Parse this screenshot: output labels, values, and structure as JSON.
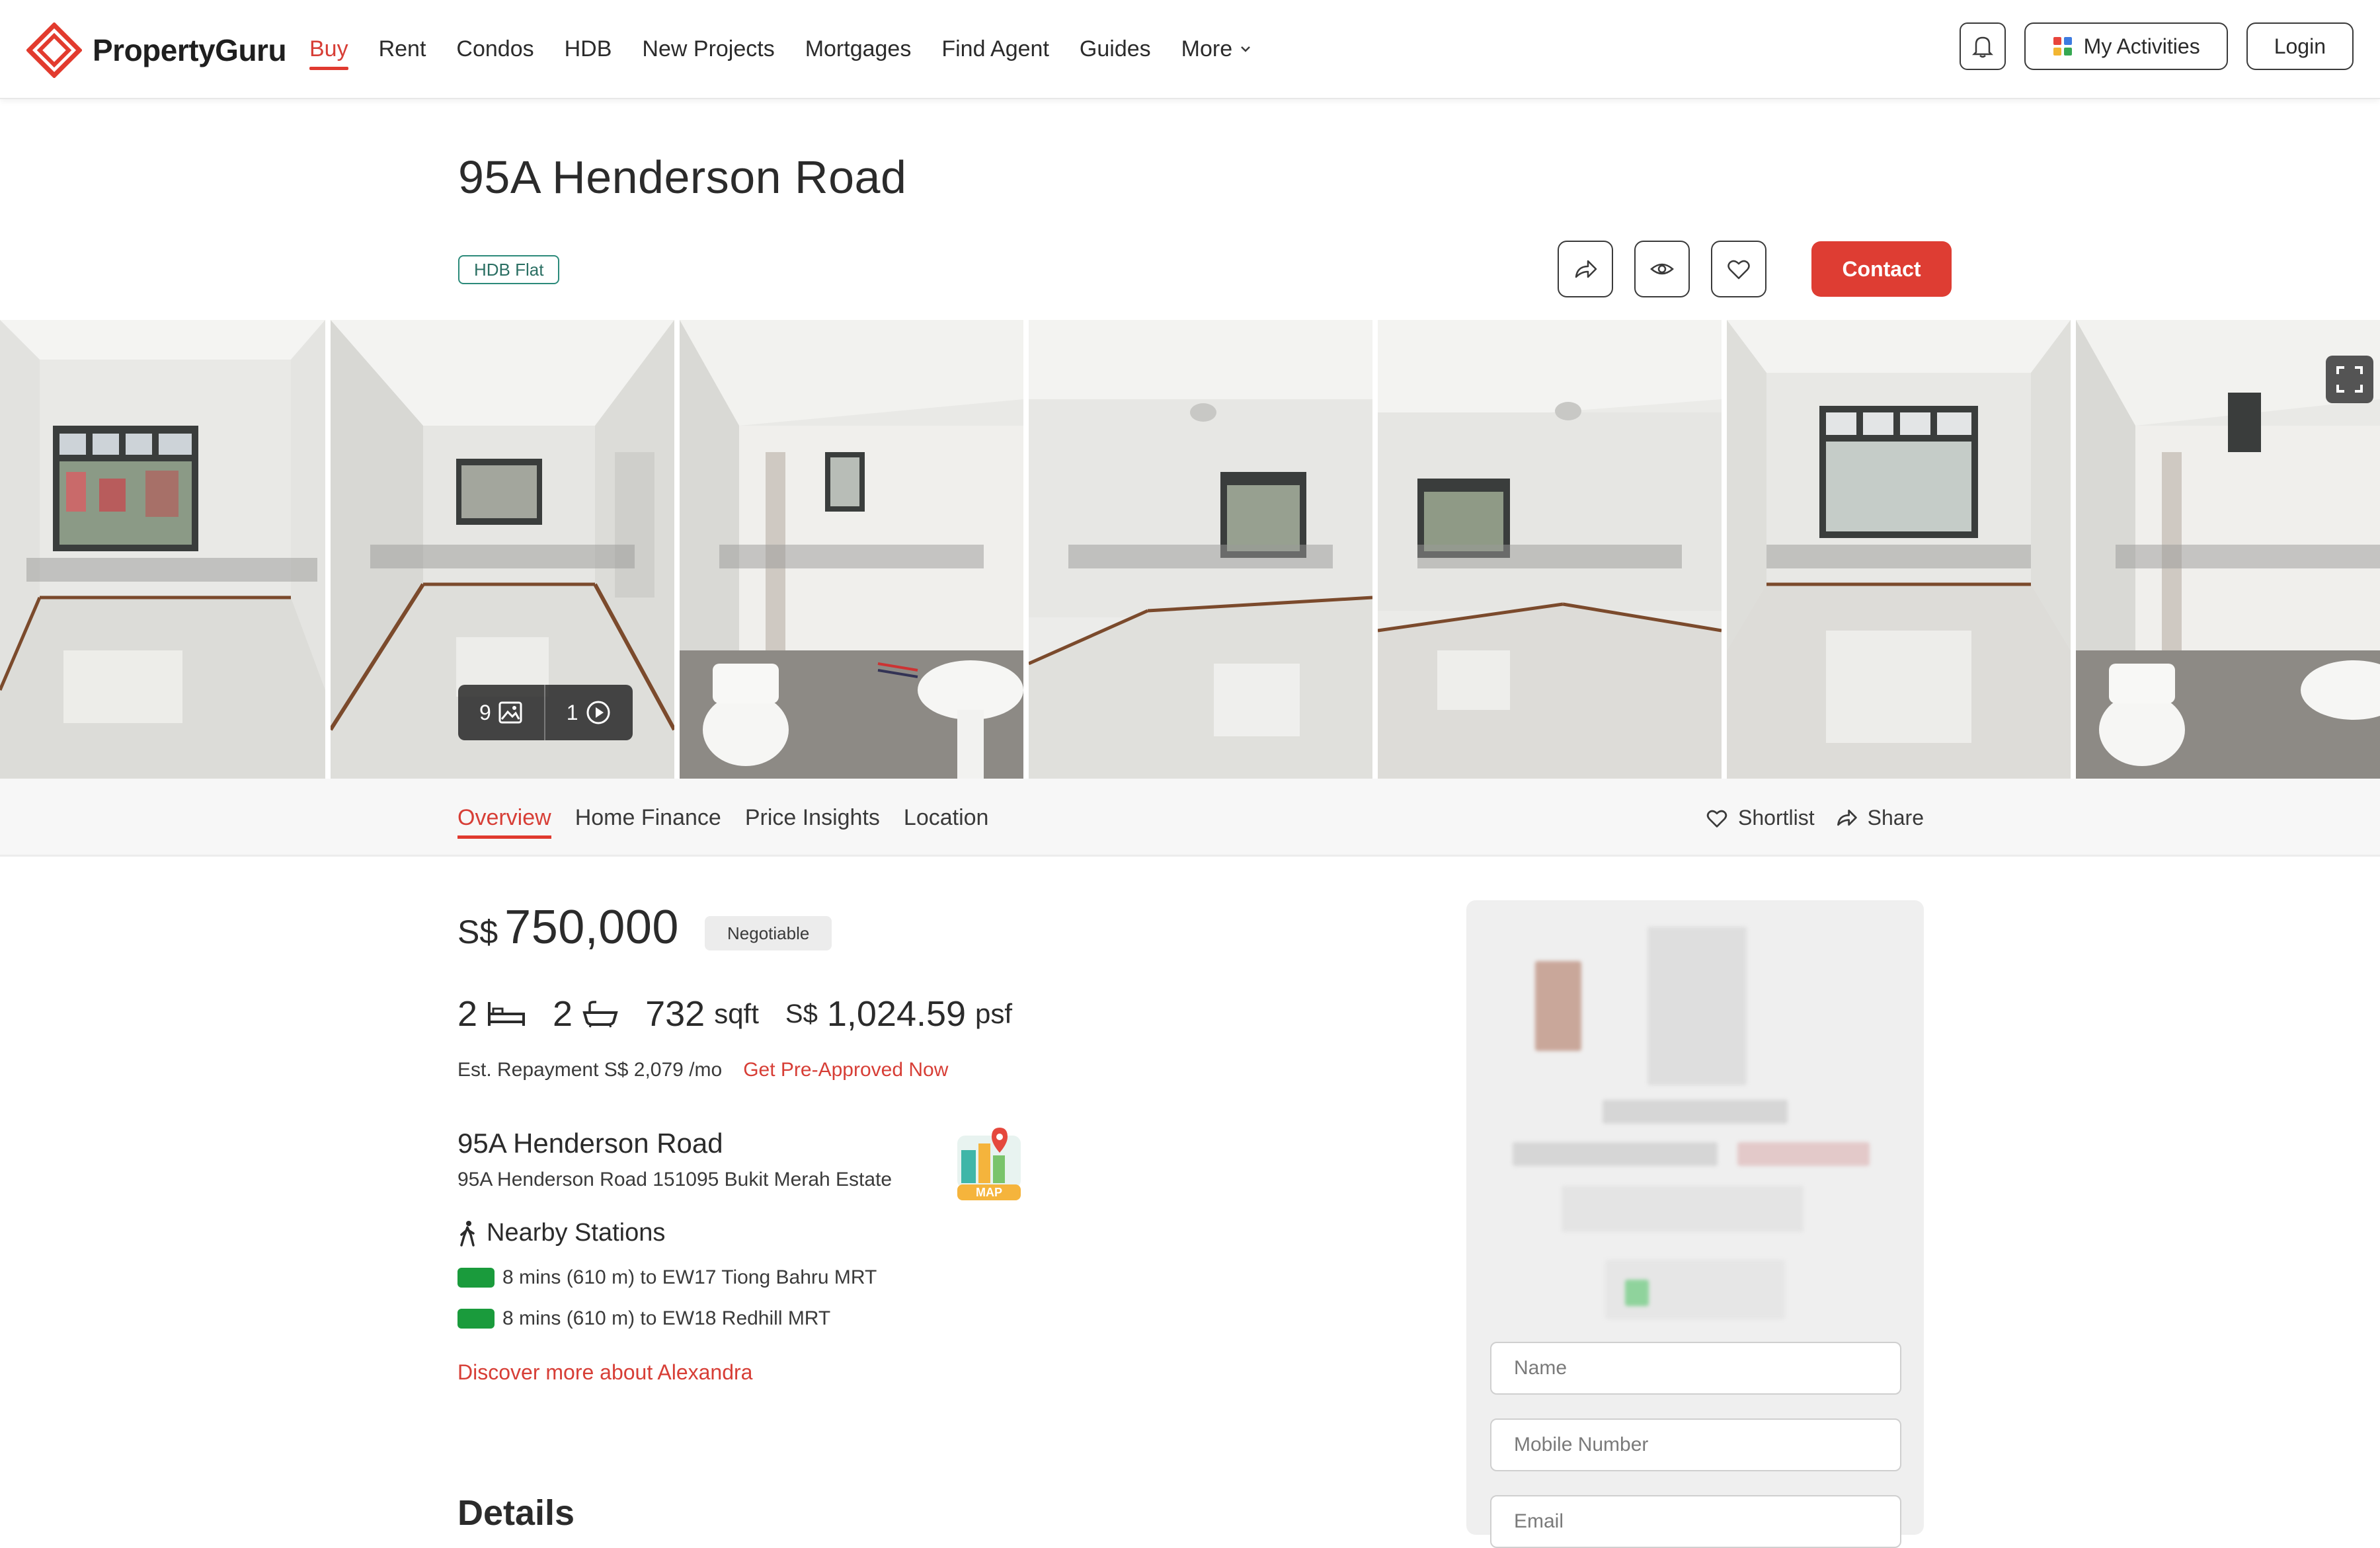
{
  "header": {
    "brand": "PropertyGuru",
    "nav": [
      {
        "label": "Buy",
        "active": true
      },
      {
        "label": "Rent"
      },
      {
        "label": "Condos"
      },
      {
        "label": "HDB"
      },
      {
        "label": "New Projects"
      },
      {
        "label": "Mortgages"
      },
      {
        "label": "Find Agent"
      },
      {
        "label": "Guides"
      },
      {
        "label": "More"
      }
    ],
    "my_activities": "My Activities",
    "login": "Login"
  },
  "listing": {
    "title": "95A Henderson Road",
    "type_tag": "HDB Flat",
    "contact_label": "Contact",
    "gallery": {
      "photo_count": "9",
      "video_count": "1"
    }
  },
  "subnav": {
    "tabs": [
      "Overview",
      "Home Finance",
      "Price Insights",
      "Location"
    ],
    "active_tab": "Overview",
    "shortlist": "Shortlist",
    "share": "Share"
  },
  "overview": {
    "currency": "S$",
    "price": "750,000",
    "negotiable": "Negotiable",
    "bedrooms": "2",
    "bathrooms": "2",
    "area_value": "732",
    "area_unit": "sqft",
    "psf_currency": "S$",
    "psf_value": "1,024.59",
    "psf_unit": "psf",
    "repayment": "Est. Repayment S$ 2,079 /mo",
    "pre_approved": "Get Pre-Approved Now",
    "address_title": "95A Henderson Road",
    "address_full": "95A Henderson Road 151095 Bukit Merah Estate",
    "map_badge": "MAP",
    "nearby_heading": "Nearby Stations",
    "stations": [
      "8 mins (610 m) to EW17 Tiong Bahru MRT",
      "8 mins (610 m) to EW18 Redhill MRT"
    ],
    "station_line_color": "#1a9b3c",
    "discover": "Discover more about Alexandra",
    "details_heading": "Details"
  },
  "agent_form": {
    "name_placeholder": "Name",
    "mobile_placeholder": "Mobile Number",
    "email_placeholder": "Email"
  },
  "colors": {
    "brand_red": "#de3d33",
    "link_red": "#d73e36",
    "tag_teal": "#2b8a7a"
  }
}
